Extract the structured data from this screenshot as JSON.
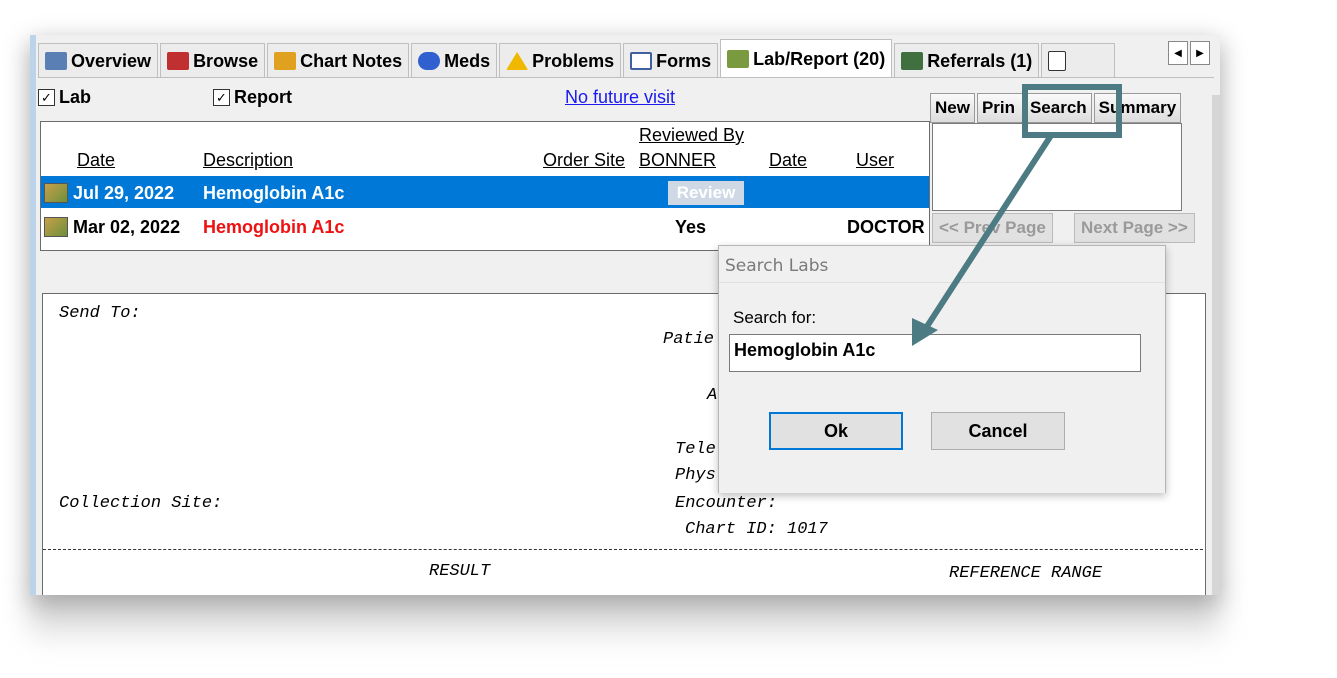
{
  "tabs": [
    {
      "label": "Overview",
      "icon": "overview-icon",
      "color": "#5a7fb5"
    },
    {
      "label": "Browse",
      "icon": "browse-icon",
      "color": "#c03030"
    },
    {
      "label": "Chart Notes",
      "icon": "chart-notes-icon",
      "color": "#e0a020"
    },
    {
      "label": "Meds",
      "icon": "meds-icon",
      "color": "#3060d0"
    },
    {
      "label": "Problems",
      "icon": "warning-icon",
      "color": "#f0b800"
    },
    {
      "label": "Forms",
      "icon": "forms-icon",
      "color": "#4060a0"
    },
    {
      "label": "Lab/Report (20)",
      "icon": "lab-icon",
      "color": "#7a9a40"
    },
    {
      "label": "Referrals (1)",
      "icon": "referrals-icon",
      "color": "#407040"
    }
  ],
  "filters": {
    "lab_label": "Lab",
    "report_label": "Report",
    "lab_checked": true,
    "report_checked": true
  },
  "visit_link": "No future visit",
  "toolbar": {
    "new": "New",
    "print": "Prin",
    "search": "Search",
    "summary": "Summary"
  },
  "list": {
    "headers": {
      "date": "Date",
      "description": "Description",
      "order_site": "Order Site",
      "reviewed_by": "Reviewed By",
      "bonner": "BONNER",
      "rev_date": "Date",
      "user": "User"
    },
    "rows": [
      {
        "date": "Jul 29, 2022",
        "description": "Hemoglobin A1c",
        "reviewed": "Review",
        "user": "",
        "selected": true
      },
      {
        "date": "Mar 02, 2022",
        "description": "Hemoglobin A1c",
        "reviewed": "Yes",
        "user": "DOCTOR",
        "selected": false,
        "desc_color": "#ee1111"
      }
    ]
  },
  "paging": {
    "prev": "<< Prev Page",
    "next": "Next Page >>"
  },
  "report": {
    "send_to": "Send To:",
    "patient": "Patie",
    "a": "A",
    "tele": "Tele",
    "phys": "Phys",
    "collection_site": "Collection Site:",
    "encounter": "Encounter:",
    "chart_id": "Chart ID: 1017",
    "result": "RESULT",
    "reference_range": "REFERENCE RANGE"
  },
  "dialog": {
    "title": "Search Labs",
    "label": "Search for:",
    "value": "Hemoglobin A1c",
    "ok": "Ok",
    "cancel": "Cancel"
  },
  "annotation_color": "#4c7b84"
}
